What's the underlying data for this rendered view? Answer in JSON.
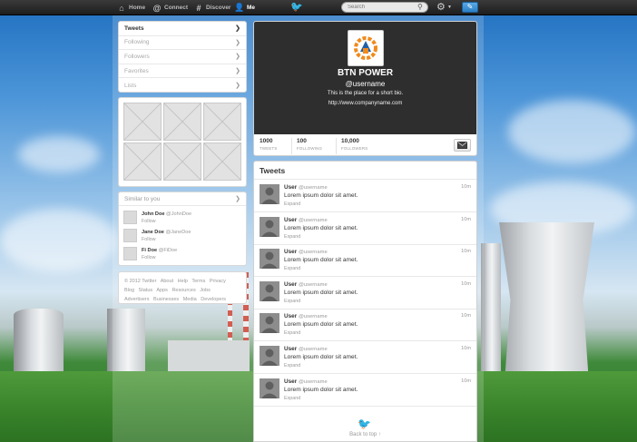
{
  "topbar": {
    "nav": [
      {
        "label": "Home",
        "icon": "home-icon"
      },
      {
        "label": "Connect",
        "icon": "at-icon"
      },
      {
        "label": "Discover",
        "icon": "hash-icon"
      },
      {
        "label": "Me",
        "icon": "user-icon"
      }
    ],
    "search_placeholder": "Search"
  },
  "sidebar": {
    "nav": [
      {
        "label": "Tweets",
        "active": true
      },
      {
        "label": "Following"
      },
      {
        "label": "Followers"
      },
      {
        "label": "Favorites"
      },
      {
        "label": "Lists"
      }
    ],
    "similar": {
      "title": "Similar to you",
      "users": [
        {
          "name": "John Doe",
          "handle": "@JohnDoe",
          "action": "Follow"
        },
        {
          "name": "Jane Doe",
          "handle": "@JaneDoe",
          "action": "Follow"
        },
        {
          "name": "Fi Doe",
          "handle": "@FiDoe",
          "action": "Follow"
        }
      ]
    },
    "footer": [
      "© 2012 Twitter",
      "About",
      "Help",
      "Terms",
      "Privacy",
      "Blog",
      "Status",
      "Apps",
      "Resources",
      "Jobs",
      "Advertisers",
      "Businesses",
      "Media",
      "Developers"
    ]
  },
  "profile": {
    "name": "BTN POWER",
    "handle": "@username",
    "bio": "This is the place for a short bio.",
    "url": "http://www.companyname.com",
    "stats": [
      {
        "value": "1000",
        "label": "TWEETS"
      },
      {
        "value": "100",
        "label": "FOLLOWING"
      },
      {
        "value": "10,000",
        "label": "FOLLOWERS"
      }
    ]
  },
  "tweets": {
    "title": "Tweets",
    "items": [
      {
        "user": "User",
        "handle": "@username",
        "text": "Lorem ipsum dolor sit amet.",
        "expand": "Expand",
        "time": "10m"
      },
      {
        "user": "User",
        "handle": "@username",
        "text": "Lorem ipsum dolor sit amet.",
        "expand": "Expand",
        "time": "10m"
      },
      {
        "user": "User",
        "handle": "@username",
        "text": "Lorem ipsum dolor sit amet.",
        "expand": "Expand",
        "time": "10m"
      },
      {
        "user": "User",
        "handle": "@username",
        "text": "Lorem ipsum dolor sit amet.",
        "expand": "Expand",
        "time": "10m"
      },
      {
        "user": "User",
        "handle": "@username",
        "text": "Lorem ipsum dolor sit amet.",
        "expand": "Expand",
        "time": "10m"
      },
      {
        "user": "User",
        "handle": "@username",
        "text": "Lorem ipsum dolor sit amet.",
        "expand": "Expand",
        "time": "10m"
      },
      {
        "user": "User",
        "handle": "@username",
        "text": "Lorem ipsum dolor sit amet.",
        "expand": "Expand",
        "time": "10m"
      }
    ],
    "back_to_top": "Back to top ↑"
  },
  "colors": {
    "topbar": "#222222",
    "accent": "#2b7fc3",
    "profile_header": "#2e2e2e",
    "logo_orange": "#f08a1c",
    "logo_blue": "#1f5fa8"
  }
}
